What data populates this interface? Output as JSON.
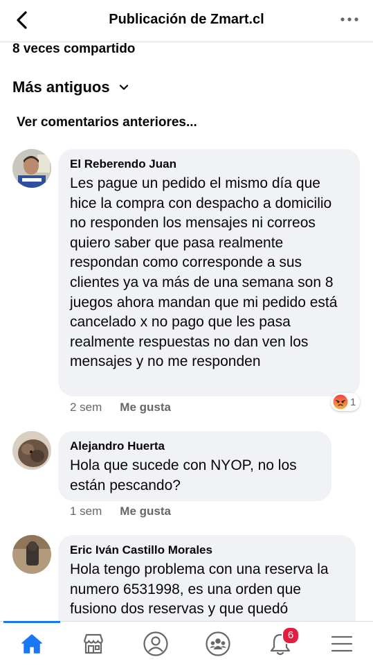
{
  "header": {
    "title": "Publicación de Zmart.cl",
    "back_icon": "chevron-left-icon",
    "more_icon": "ellipsis-icon"
  },
  "post": {
    "shares": "8 veces compartido"
  },
  "sort": {
    "label": "Más antiguos"
  },
  "previous_comments_label": "Ver comentarios anteriores...",
  "comments": [
    {
      "author": "El Reberendo Juan",
      "text": "Les pague un pedido el mismo día que hice la compra con despacho a domicilio no responden los mensajes ni correos quiero saber que pasa realmente  respondan como corresponde a sus clientes ya va más de una semana son 8 juegos ahora mandan que mi pedido está cancelado x no pago que les pasa realmente respuestas no dan ven los mensajes y no me responden",
      "time": "2 sem",
      "like": "Me gusta",
      "reaction_icon": "angry-face-icon",
      "reaction_count": "1"
    },
    {
      "author": "Alejandro Huerta",
      "text": "Hola que sucede con NYOP, no los están pescando?",
      "time": "1 sem",
      "like": "Me gusta"
    },
    {
      "author": "Eric Iván Castillo Morales",
      "text": "Hola tengo problema con una reserva la numero 6531998, es una orden que fusiono dos reservas y que quedó"
    }
  ],
  "tabs": [
    {
      "icon": "home-icon",
      "active": true
    },
    {
      "icon": "marketplace-icon"
    },
    {
      "icon": "profile-icon"
    },
    {
      "icon": "groups-icon"
    },
    {
      "icon": "bell-icon",
      "badge": "6"
    },
    {
      "icon": "menu-icon"
    }
  ],
  "colors": {
    "accent": "#1877f2",
    "bubble": "#f0f2f5",
    "badge": "#e41e3f",
    "secondary_text": "#65676b"
  }
}
